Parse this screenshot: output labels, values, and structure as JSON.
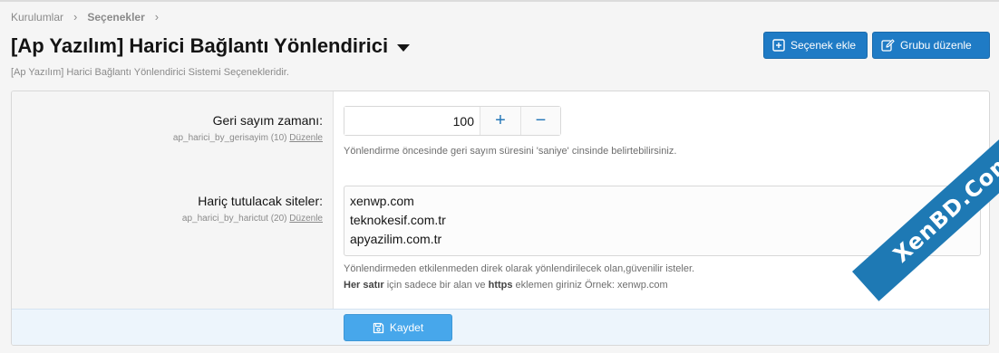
{
  "breadcrumb": {
    "items": [
      "Kurulumlar",
      "Seçenekler"
    ]
  },
  "page": {
    "title": "[Ap Yazılım] Harici Bağlantı Yönlendirici",
    "description": "[Ap Yazılım] Harici Bağlantı Yönlendirici Sistemi Seçenekleridir."
  },
  "toolbar": {
    "add_option_label": "Seçenek ekle",
    "edit_group_label": "Grubu düzenle"
  },
  "options": [
    {
      "label": "Geri sayım zamanı:",
      "key": "ap_harici_by_gerisayim (10)",
      "edit_label": "Düzenle",
      "value": "100",
      "increment": "+",
      "decrement": "−",
      "hint": "Yönlendirme öncesinde geri sayım süresini 'saniye' cinsinde belirtebilirsiniz."
    },
    {
      "label": "Hariç tutulacak siteler:",
      "key": "ap_harici_by_harictut (20)",
      "edit_label": "Düzenle",
      "lines": [
        "xenwp.com",
        "teknokesif.com.tr",
        "apyazilim.com.tr"
      ],
      "hint_line1": "Yönlendirmeden etkilenmeden direk olarak yönlendirilecek olan,güvenilir isteler.",
      "hint_line2_bold1": "Her satır",
      "hint_line2_mid": " için sadece bir alan ve ",
      "hint_line2_bold2": "https",
      "hint_line2_end": " eklemen giriniz Örnek: xenwp.com"
    }
  ],
  "footer": {
    "save_label": "Kaydet"
  },
  "watermark": {
    "text": "XenBD.Com"
  },
  "colors": {
    "primary": "#1f7bc5",
    "save": "#47a7eb",
    "footer_bg": "#edf5fc",
    "watermark": "#1e79b4"
  }
}
